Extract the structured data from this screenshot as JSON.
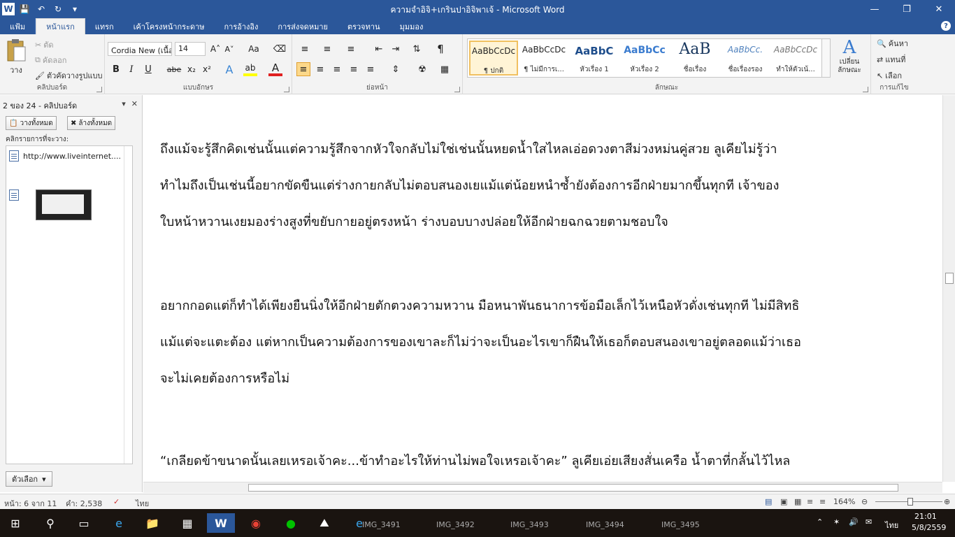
{
  "title_bar": {
    "title": "ความจำอิจิ+เกรินปาอิจิพาเจ้ - Microsoft Word",
    "minimize": "—",
    "maximize": "❐",
    "close": "✕"
  },
  "ribbon_tabs": [
    "แฟ้ม",
    "หน้าแรก",
    "แทรก",
    "เค้าโครงหน้ากระดาษ",
    "การอ้างอิง",
    "การส่งจดหมาย",
    "ตรวจทาน",
    "มุมมอง"
  ],
  "ribbon": {
    "clipboard": {
      "paste_label": "วาง",
      "cut": "ตัด",
      "copy": "คัดลอก",
      "format_painter": "ตัวคัดวางรูปแบบ",
      "group_label": "คลิปบอร์ด"
    },
    "font": {
      "font_name": "Cordia New (เนื้อ",
      "font_size": "14",
      "group_label": "แบบอักษร",
      "bold": "B",
      "italic": "I",
      "underline": "U",
      "strike": "abe",
      "subscript": "x₂",
      "superscript": "x²",
      "grow": "A˄",
      "shrink": "A˅",
      "case": "Aa",
      "effects": "A",
      "highlight": "ab",
      "color": "A"
    },
    "paragraph": {
      "group_label": "ย่อหน้า",
      "show_marks": "¶"
    },
    "styles": {
      "group_label": "ลักษณะ",
      "items": [
        {
          "sample": "AaBbCcDc",
          "name": "¶ ปกติ"
        },
        {
          "sample": "AaBbCcDc",
          "name": "¶ ไม่มีการเ..."
        },
        {
          "sample": "AaBbC",
          "name": "หัวเรื่อง 1"
        },
        {
          "sample": "AaBbCc",
          "name": "หัวเรื่อง 2"
        },
        {
          "sample": "AaB",
          "name": "ชื่อเรื่อง"
        },
        {
          "sample": "AaBbCc.",
          "name": "ชื่อเรื่องรอง"
        },
        {
          "sample": "AaBbCcDc",
          "name": "ทำให้ตัวเน้..."
        }
      ],
      "change_styles": "เปลี่ยน ลักษณะ"
    },
    "editing": {
      "group_label": "การแก้ไข",
      "find": "ค้นหา",
      "replace": "แทนที่",
      "select": "เลือก"
    }
  },
  "clipboard_pane": {
    "header": "2 ของ 24 - คลิปบอร์ด",
    "paste_all": "วางทั้งหมด",
    "clear_all": "ล้างทั้งหมด",
    "subtitle": "คลิกรายการที่จะวาง:",
    "items": [
      {
        "text": "http://www.liveinternet...."
      },
      {
        "text": ""
      }
    ],
    "options": "ตัวเลือก"
  },
  "document": {
    "paragraphs": [
      [
        "ถึงแม้จะรู้สึกคิดเช่นนั้นแต่ความรู้สึกจากหัวใจกลับไม่ใช่เช่นนั้นหยดน้ำใสไหลเอ่อดวงตาสีม่วงหม่นคู่สวย ลูเคียไม่รู้ว่า",
        "ทำไมถึงเป็นเช่นนี้อยากขัดขืนแต่ร่างกายกลับไม่ตอบสนองเยแม้แต่น้อยหนำซ้ำยังต้องการอีกฝ่ายมากขึ้นทุกที เจ้าของ",
        "ใบหน้าหวานเงยมองร่างสูงที่ขยับกายอยู่ตรงหน้า ร่างบอบบางปล่อยให้อีกฝ่ายฉกฉวยตามชอบใจ"
      ],
      [
        "อยากกอดแต่ก็ทำได้เพียงยืนนิ่งให้อีกฝ่ายตักตวงความหวาน มือหนาพันธนาการข้อมือเล็กไว้เหนือหัวดั่งเช่นทุกที ไม่มีสิทธิ",
        "แม้แต่จะแตะต้อง แต่หากเป็นความต้องการของเขาละก็ไม่ว่าจะเป็นอะไรเขาก็ฝืนให้เธอก็ตอบสนองเขาอยู่ตลอดแม้ว่าเธอ",
        "จะไม่เคยต้องการหรือไม่"
      ],
      [
        "“เกลียดข้าขนาดนั้นเลยเหรอเจ้าคะ...ข้าทำอะไรให้ท่านไม่พอใจเหรอเจ้าคะ” ลูเคียเอ่ยเสียงสั่นเครือ น้ำตาที่กลั้นไว้ไหล"
      ]
    ]
  },
  "status_bar": {
    "page": "หน้า: 6 จาก 11",
    "words": "คำ: 2,538",
    "language": "ไทย",
    "zoom": "164%",
    "zoom_value": 1.64
  },
  "taskbar": {
    "labels": [
      "IMG_3491",
      "IMG_3492",
      "IMG_3493",
      "IMG_3494",
      "IMG_3495"
    ],
    "tray_lang": "ไทย",
    "time": "21:01",
    "date": "5/8/2559"
  }
}
